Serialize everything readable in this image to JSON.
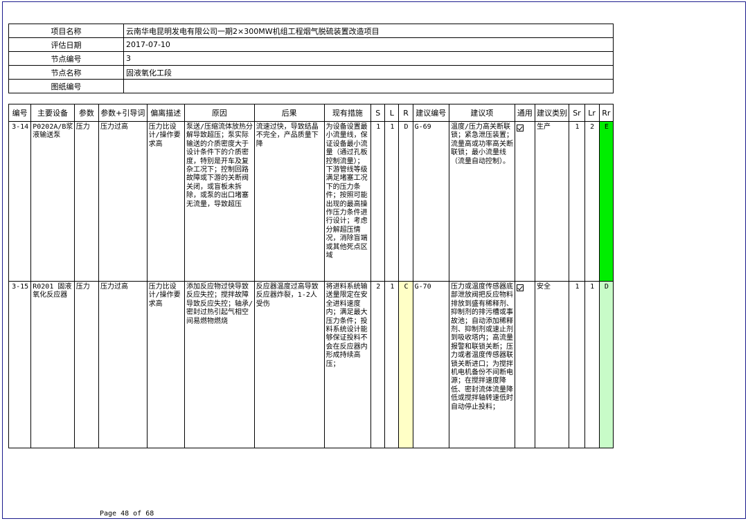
{
  "info": {
    "rows": [
      {
        "label": "项目名称",
        "value": "云南华电昆明发电有限公司一期2×300MW机组工程烟气脱硫装置改造项目"
      },
      {
        "label": "评估日期",
        "value": "2017-07-10"
      },
      {
        "label": "节点编号",
        "value": "3"
      },
      {
        "label": "节点名称",
        "value": "固液氧化工段"
      },
      {
        "label": "图纸编号",
        "value": ""
      }
    ]
  },
  "table": {
    "headers": [
      "编号",
      "主要设备",
      "参数",
      "参数+引导词",
      "偏离描述",
      "原因",
      "后果",
      "现有措施",
      "S",
      "L",
      "R",
      "建议编号",
      "建议项",
      "通用",
      "建议类别",
      "Sr",
      "Lr",
      "Rr"
    ],
    "rows": [
      {
        "no": "3-14",
        "equipment": "P0202A/B浆液输送泵",
        "param": "压力",
        "guideword": "压力过高",
        "deviation": "压力比设计/操作要求高",
        "cause": "泵送/压缩流体放热分解导致超压；泵实际输送的介质密度大于设计条件下的介质密度，特别是开车及复杂工况下；控制回路故障或下游的关断阀关闭，或盲板未拆除，或泵的出口堵塞无流量，导致超压",
        "consequence": "流速过快，导致结晶不完全，产品质量下降",
        "measures": "为设备设置最小流量线，保证设备最小流量（通过孔板控制流量）；下游管线等级满足堵塞工况下的压力条件；按照可能出现的最高操作压力条件进行设计；考虑分解超压情况，消除盲端或其他死点区域",
        "s": "1",
        "l": "1",
        "r": "D",
        "rec_no": "G-69",
        "recommendation": "温度/压力高关断联锁；紧急泄压装置；流量高或功率高关断联锁；最小流量线（流量自动控制）。",
        "category": "生产",
        "sr": "1",
        "lr": "2",
        "rr": "E"
      },
      {
        "no": "3-15",
        "equipment": "R0201 固液氧化反应器",
        "param": "压力",
        "guideword": "压力过高",
        "deviation": "压力比设计/操作要求高",
        "cause": "添加反应物过快导致反应失控；搅拌故障导致反应失控；轴承/密封过热引起气相空间易燃物燃烧",
        "consequence": "反应器温度过高导致反应器炸裂，1-2人受伤",
        "measures": "将进料系统输送量限定在安全进料速度内；满足最大压力条件；投料系统设计能够保证投料不会在反应器内形成持续高压；",
        "s": "2",
        "l": "1",
        "r": "C",
        "rec_no": "G-70",
        "recommendation": "压力或温度传感器底部泄放阀把反应物料排放到盛有稀释剂、抑制剂的排污槽或事故池；自动添加稀释剂、抑制剂或速止剂到吸收塔内；高流量报警和联锁关断；压力或者温度传感器联锁关断进口；为搅拌机电机备份不间断电源；在搅拌速度降低、密封流体流量降低或搅拌轴转速低时自动停止投料；",
        "category": "安全",
        "sr": "1",
        "lr": "1",
        "rr": "D"
      }
    ]
  },
  "footer": {
    "page_text": "Page 48 of 68"
  },
  "colors": {
    "r_c": "#ffffc6",
    "rr_e": "#00ee00",
    "rr_d": "#c8fbc8",
    "frame": "#1a1a8c"
  }
}
